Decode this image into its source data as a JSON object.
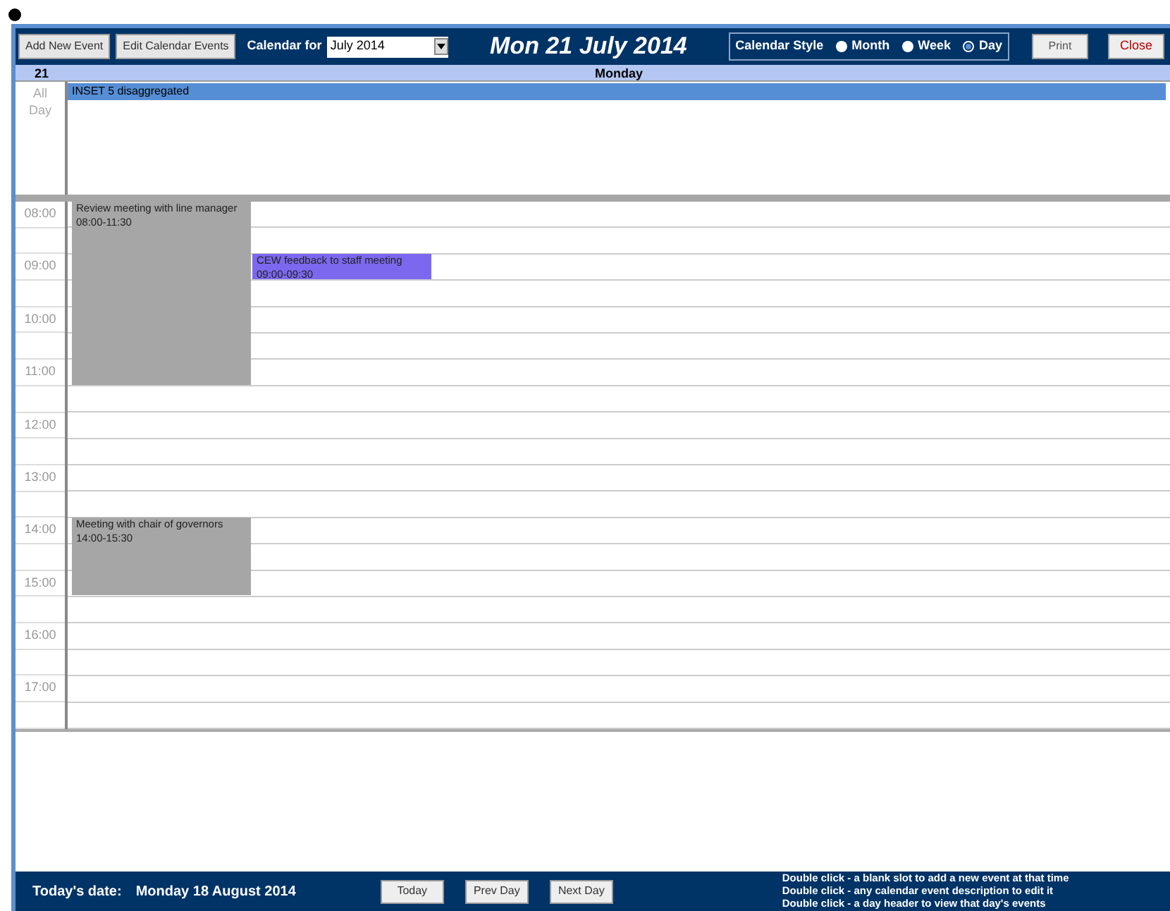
{
  "toolbar": {
    "buttons": [
      {
        "label": "Add New Event"
      },
      {
        "label": "Edit Calendar Events"
      }
    ],
    "calendar_for": {
      "label": "Calendar for",
      "value": "July 2014"
    },
    "title": "Mon 21 July 2014",
    "style": {
      "label": "Calendar Style",
      "options": [
        {
          "label": "Month",
          "selected": false
        },
        {
          "label": "Week",
          "selected": false
        },
        {
          "label": "Day",
          "selected": true
        }
      ]
    },
    "print": "Print",
    "close": "Close"
  },
  "day_header": {
    "date": "21",
    "weekday": "Monday"
  },
  "all_day": {
    "label": [
      "All",
      "Day"
    ],
    "events": [
      {
        "title": "INSET 5 disaggregated",
        "color": "#558ed5"
      }
    ]
  },
  "hours": [
    "08:00",
    "09:00",
    "10:00",
    "11:00",
    "12:00",
    "13:00",
    "14:00",
    "15:00",
    "16:00",
    "17:00"
  ],
  "events": [
    {
      "title": "Review meeting with line manager",
      "time": "08:00-11:30",
      "color": "#a6a6a6"
    },
    {
      "title": "CEW feedback to staff meeting",
      "time": "09:00-09:30",
      "color": "#7b68ee"
    },
    {
      "title": "Meeting with chair of governors",
      "time": "14:00-15:30",
      "color": "#a6a6a6"
    }
  ],
  "footer": {
    "today_label": "Today's date:",
    "today_value": "Monday 18 August 2014",
    "buttons": [
      "Today",
      "Prev Day",
      "Next Day"
    ],
    "hints": [
      "Double click - a blank slot to add a new event at that time",
      "Double click - any calendar event description to edit it",
      "Double click - a day header to view that day's events"
    ]
  }
}
